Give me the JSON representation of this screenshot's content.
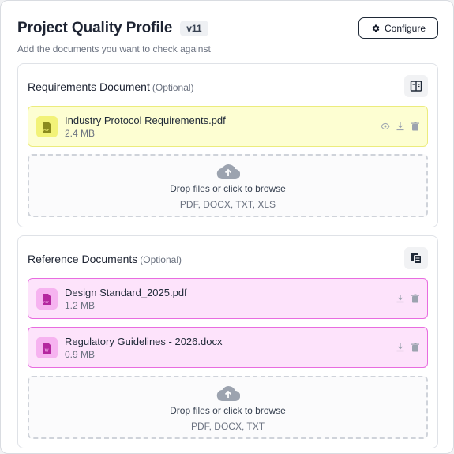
{
  "header": {
    "title": "Project Quality Profile",
    "version": "v11",
    "subtitle": "Add the documents you want to check against",
    "configure_label": "Configure"
  },
  "requirements": {
    "title": "Requirements Document",
    "optional": "(Optional)",
    "icon": "book-icon",
    "files": [
      {
        "name": "Industry Protocol Requirements.pdf",
        "size": "2.4 MB",
        "type": "pdf",
        "actions": [
          "view",
          "download",
          "delete"
        ]
      }
    ],
    "dropzone": {
      "label": "Drop files or click to browse",
      "types": "PDF, DOCX, TXT, XLS"
    }
  },
  "reference": {
    "title": "Reference Documents",
    "optional": "(Optional)",
    "icon": "documents-stack-icon",
    "files": [
      {
        "name": "Design Standard_2025.pdf",
        "size": "1.2 MB",
        "type": "pdf",
        "actions": [
          "download",
          "delete"
        ]
      },
      {
        "name": "Regulatory Guidelines - 2026.docx",
        "size": "0.9 MB",
        "type": "docx",
        "actions": [
          "download",
          "delete"
        ]
      }
    ],
    "dropzone": {
      "label": "Drop files or click to browse",
      "types": "PDF, DOCX, TXT"
    }
  },
  "colors": {
    "requirements_card_bg": "#fdfed2",
    "requirements_card_border": "#ecec7d",
    "reference_card_bg": "#fde3fb",
    "reference_card_border": "#e86ce0",
    "pdf_icon_color": "#8a8a1e",
    "ref_icon_color": "#b4279f"
  }
}
